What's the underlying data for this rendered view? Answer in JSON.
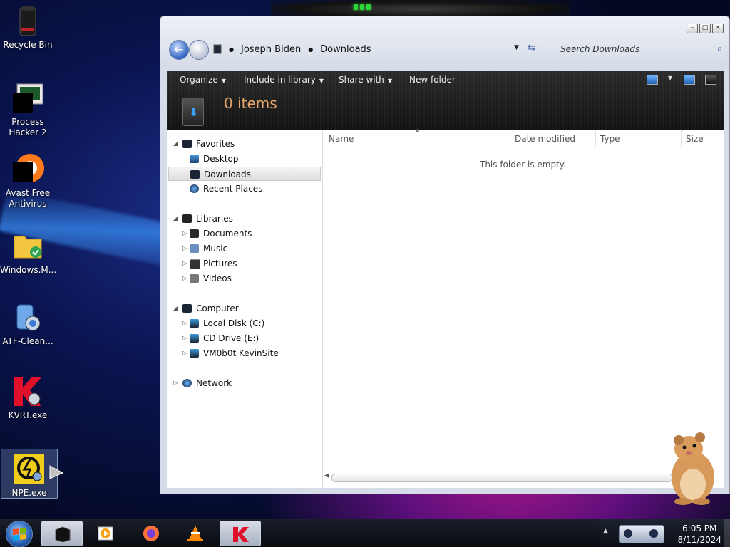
{
  "desktop": {
    "icons": [
      {
        "label": "Recycle Bin"
      },
      {
        "label": "Process Hacker 2"
      },
      {
        "label": "Avast Free Antivirus"
      },
      {
        "label": "Windows.M..."
      },
      {
        "label": "ATF-Clean..."
      },
      {
        "label": "KVRT.exe"
      },
      {
        "label": "NPE.exe"
      }
    ]
  },
  "window": {
    "breadcrumb": [
      "Joseph Biden",
      "Downloads"
    ],
    "search_placeholder": "Search Downloads",
    "toolbar": {
      "organize": "Organize",
      "include_in_library": "Include in library",
      "share_with": "Share with",
      "new_folder": "New folder"
    },
    "item_count": "0 items",
    "nav": {
      "favorites": "Favorites",
      "desktop": "Desktop",
      "downloads": "Downloads",
      "recent_places": "Recent Places",
      "libraries": "Libraries",
      "documents": "Documents",
      "music": "Music",
      "pictures": "Pictures",
      "videos": "Videos",
      "computer": "Computer",
      "local_disk": "Local Disk (C:)",
      "cd_drive": "CD Drive (E:)",
      "vm_share": "VM0b0t KevinSite",
      "network": "Network"
    },
    "columns": [
      "Name",
      "Date modified",
      "Type",
      "Size"
    ],
    "empty_message": "This folder is empty."
  },
  "taskbar": {
    "time": "6:05 PM",
    "date": "8/11/2024"
  },
  "colors": {
    "accent": "#2f63c4",
    "item_count": "#e9a66c"
  }
}
